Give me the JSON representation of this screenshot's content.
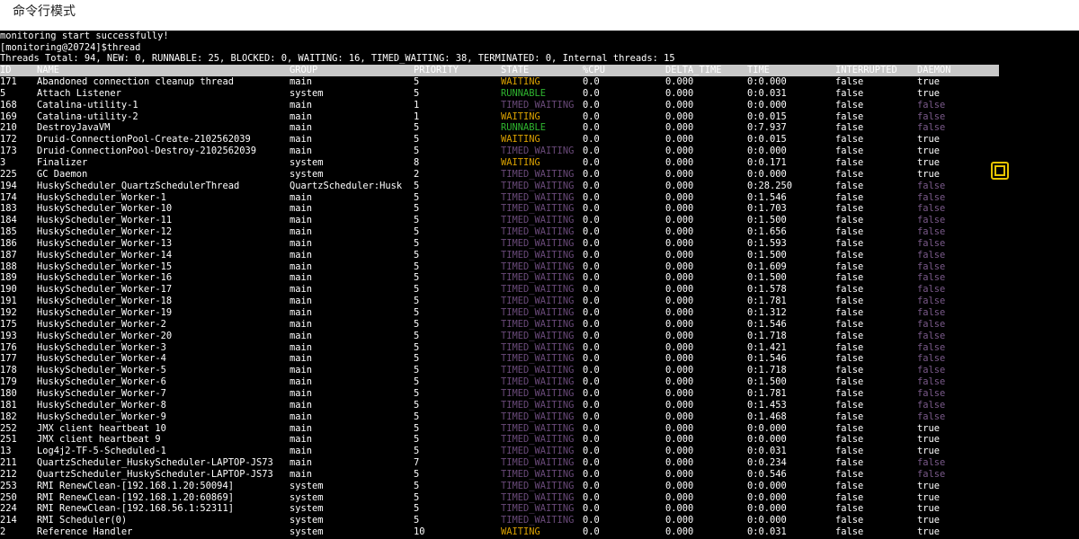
{
  "header": {
    "title": "命令行模式"
  },
  "console": {
    "lines": [
      "monitoring start successfully!",
      "[monitoring@20724]$thread",
      "Threads Total: 94, NEW: 0, RUNNABLE: 25, BLOCKED: 0, WAITING: 16, TIMED_WAITING: 38, TERMINATED: 0, Internal threads: 15"
    ]
  },
  "table": {
    "columns": [
      "ID",
      "NAME",
      "GROUP",
      "PRIORITY",
      "STATE",
      "%CPU",
      "DELTA_TIME",
      "TIME",
      "INTERRUPTED",
      "DAEMON"
    ],
    "rows": [
      [
        "171",
        "Abandoned connection cleanup thread",
        "main",
        "5",
        "WAITING",
        "0.0",
        "0.000",
        "0:0.000",
        "false",
        "true"
      ],
      [
        "5",
        "Attach Listener",
        "system",
        "5",
        "RUNNABLE",
        "0.0",
        "0.000",
        "0:0.031",
        "false",
        "true"
      ],
      [
        "168",
        "Catalina-utility-1",
        "main",
        "1",
        "TIMED_WAITING",
        "0.0",
        "0.000",
        "0:0.000",
        "false",
        "false"
      ],
      [
        "169",
        "Catalina-utility-2",
        "main",
        "1",
        "WAITING",
        "0.0",
        "0.000",
        "0:0.015",
        "false",
        "false"
      ],
      [
        "210",
        "DestroyJavaVM",
        "main",
        "5",
        "RUNNABLE",
        "0.0",
        "0.000",
        "0:7.937",
        "false",
        "false"
      ],
      [
        "172",
        "Druid-ConnectionPool-Create-2102562039",
        "main",
        "5",
        "WAITING",
        "0.0",
        "0.000",
        "0:0.015",
        "false",
        "true"
      ],
      [
        "173",
        "Druid-ConnectionPool-Destroy-2102562039",
        "main",
        "5",
        "TIMED_WAITING",
        "0.0",
        "0.000",
        "0:0.000",
        "false",
        "true"
      ],
      [
        "3",
        "Finalizer",
        "system",
        "8",
        "WAITING",
        "0.0",
        "0.000",
        "0:0.171",
        "false",
        "true"
      ],
      [
        "225",
        "GC Daemon",
        "system",
        "2",
        "TIMED_WAITING",
        "0.0",
        "0.000",
        "0:0.000",
        "false",
        "true"
      ],
      [
        "194",
        "HuskyScheduler_QuartzSchedulerThread",
        "QuartzScheduler:Husk",
        "5",
        "TIMED_WAITING",
        "0.0",
        "0.000",
        "0:28.250",
        "false",
        "false"
      ],
      [
        "174",
        "HuskyScheduler_Worker-1",
        "main",
        "5",
        "TIMED_WAITING",
        "0.0",
        "0.000",
        "0:1.546",
        "false",
        "false"
      ],
      [
        "183",
        "HuskyScheduler_Worker-10",
        "main",
        "5",
        "TIMED_WAITING",
        "0.0",
        "0.000",
        "0:1.703",
        "false",
        "false"
      ],
      [
        "184",
        "HuskyScheduler_Worker-11",
        "main",
        "5",
        "TIMED_WAITING",
        "0.0",
        "0.000",
        "0:1.500",
        "false",
        "false"
      ],
      [
        "185",
        "HuskyScheduler_Worker-12",
        "main",
        "5",
        "TIMED_WAITING",
        "0.0",
        "0.000",
        "0:1.656",
        "false",
        "false"
      ],
      [
        "186",
        "HuskyScheduler_Worker-13",
        "main",
        "5",
        "TIMED_WAITING",
        "0.0",
        "0.000",
        "0:1.593",
        "false",
        "false"
      ],
      [
        "187",
        "HuskyScheduler_Worker-14",
        "main",
        "5",
        "TIMED_WAITING",
        "0.0",
        "0.000",
        "0:1.500",
        "false",
        "false"
      ],
      [
        "188",
        "HuskyScheduler_Worker-15",
        "main",
        "5",
        "TIMED_WAITING",
        "0.0",
        "0.000",
        "0:1.609",
        "false",
        "false"
      ],
      [
        "189",
        "HuskyScheduler_Worker-16",
        "main",
        "5",
        "TIMED_WAITING",
        "0.0",
        "0.000",
        "0:1.500",
        "false",
        "false"
      ],
      [
        "190",
        "HuskyScheduler_Worker-17",
        "main",
        "5",
        "TIMED_WAITING",
        "0.0",
        "0.000",
        "0:1.578",
        "false",
        "false"
      ],
      [
        "191",
        "HuskyScheduler_Worker-18",
        "main",
        "5",
        "TIMED_WAITING",
        "0.0",
        "0.000",
        "0:1.781",
        "false",
        "false"
      ],
      [
        "192",
        "HuskyScheduler_Worker-19",
        "main",
        "5",
        "TIMED_WAITING",
        "0.0",
        "0.000",
        "0:1.312",
        "false",
        "false"
      ],
      [
        "175",
        "HuskyScheduler_Worker-2",
        "main",
        "5",
        "TIMED_WAITING",
        "0.0",
        "0.000",
        "0:1.546",
        "false",
        "false"
      ],
      [
        "193",
        "HuskyScheduler_Worker-20",
        "main",
        "5",
        "TIMED_WAITING",
        "0.0",
        "0.000",
        "0:1.718",
        "false",
        "false"
      ],
      [
        "176",
        "HuskyScheduler_Worker-3",
        "main",
        "5",
        "TIMED_WAITING",
        "0.0",
        "0.000",
        "0:1.421",
        "false",
        "false"
      ],
      [
        "177",
        "HuskyScheduler_Worker-4",
        "main",
        "5",
        "TIMED_WAITING",
        "0.0",
        "0.000",
        "0:1.546",
        "false",
        "false"
      ],
      [
        "178",
        "HuskyScheduler_Worker-5",
        "main",
        "5",
        "TIMED_WAITING",
        "0.0",
        "0.000",
        "0:1.718",
        "false",
        "false"
      ],
      [
        "179",
        "HuskyScheduler_Worker-6",
        "main",
        "5",
        "TIMED_WAITING",
        "0.0",
        "0.000",
        "0:1.500",
        "false",
        "false"
      ],
      [
        "180",
        "HuskyScheduler_Worker-7",
        "main",
        "5",
        "TIMED_WAITING",
        "0.0",
        "0.000",
        "0:1.781",
        "false",
        "false"
      ],
      [
        "181",
        "HuskyScheduler_Worker-8",
        "main",
        "5",
        "TIMED_WAITING",
        "0.0",
        "0.000",
        "0:1.453",
        "false",
        "false"
      ],
      [
        "182",
        "HuskyScheduler_Worker-9",
        "main",
        "5",
        "TIMED_WAITING",
        "0.0",
        "0.000",
        "0:1.468",
        "false",
        "false"
      ],
      [
        "252",
        "JMX client heartbeat 10",
        "main",
        "5",
        "TIMED_WAITING",
        "0.0",
        "0.000",
        "0:0.000",
        "false",
        "true"
      ],
      [
        "251",
        "JMX client heartbeat 9",
        "main",
        "5",
        "TIMED_WAITING",
        "0.0",
        "0.000",
        "0:0.000",
        "false",
        "true"
      ],
      [
        "13",
        "Log4j2-TF-5-Scheduled-1",
        "main",
        "5",
        "TIMED_WAITING",
        "0.0",
        "0.000",
        "0:0.031",
        "false",
        "true"
      ],
      [
        "211",
        "QuartzScheduler_HuskyScheduler-LAPTOP-JS73",
        "main",
        "7",
        "TIMED_WAITING",
        "0.0",
        "0.000",
        "0:0.234",
        "false",
        "false"
      ],
      [
        "212",
        "QuartzScheduler_HuskyScheduler-LAPTOP-JS73",
        "main",
        "5",
        "TIMED_WAITING",
        "0.0",
        "0.000",
        "0:0.546",
        "false",
        "false"
      ],
      [
        "253",
        "RMI RenewClean-[192.168.1.20:50094]",
        "system",
        "5",
        "TIMED_WAITING",
        "0.0",
        "0.000",
        "0:0.000",
        "false",
        "true"
      ],
      [
        "250",
        "RMI RenewClean-[192.168.1.20:60869]",
        "system",
        "5",
        "TIMED_WAITING",
        "0.0",
        "0.000",
        "0:0.000",
        "false",
        "true"
      ],
      [
        "224",
        "RMI RenewClean-[192.168.56.1:52311]",
        "system",
        "5",
        "TIMED_WAITING",
        "0.0",
        "0.000",
        "0:0.000",
        "false",
        "true"
      ],
      [
        "214",
        "RMI Scheduler(0)",
        "system",
        "5",
        "TIMED_WAITING",
        "0.0",
        "0.000",
        "0:0.000",
        "false",
        "true"
      ],
      [
        "2",
        "Reference Handler",
        "system",
        "10",
        "WAITING",
        "0.0",
        "0.000",
        "0:0.031",
        "false",
        "true"
      ]
    ]
  },
  "colors": {
    "waiting": "#d9a000",
    "runnable": "#2fb52f",
    "timed_waiting": "#6a4a7a",
    "fullscreen_accent": "#e8c400"
  },
  "icons": {
    "fullscreen": "fullscreen-icon"
  }
}
